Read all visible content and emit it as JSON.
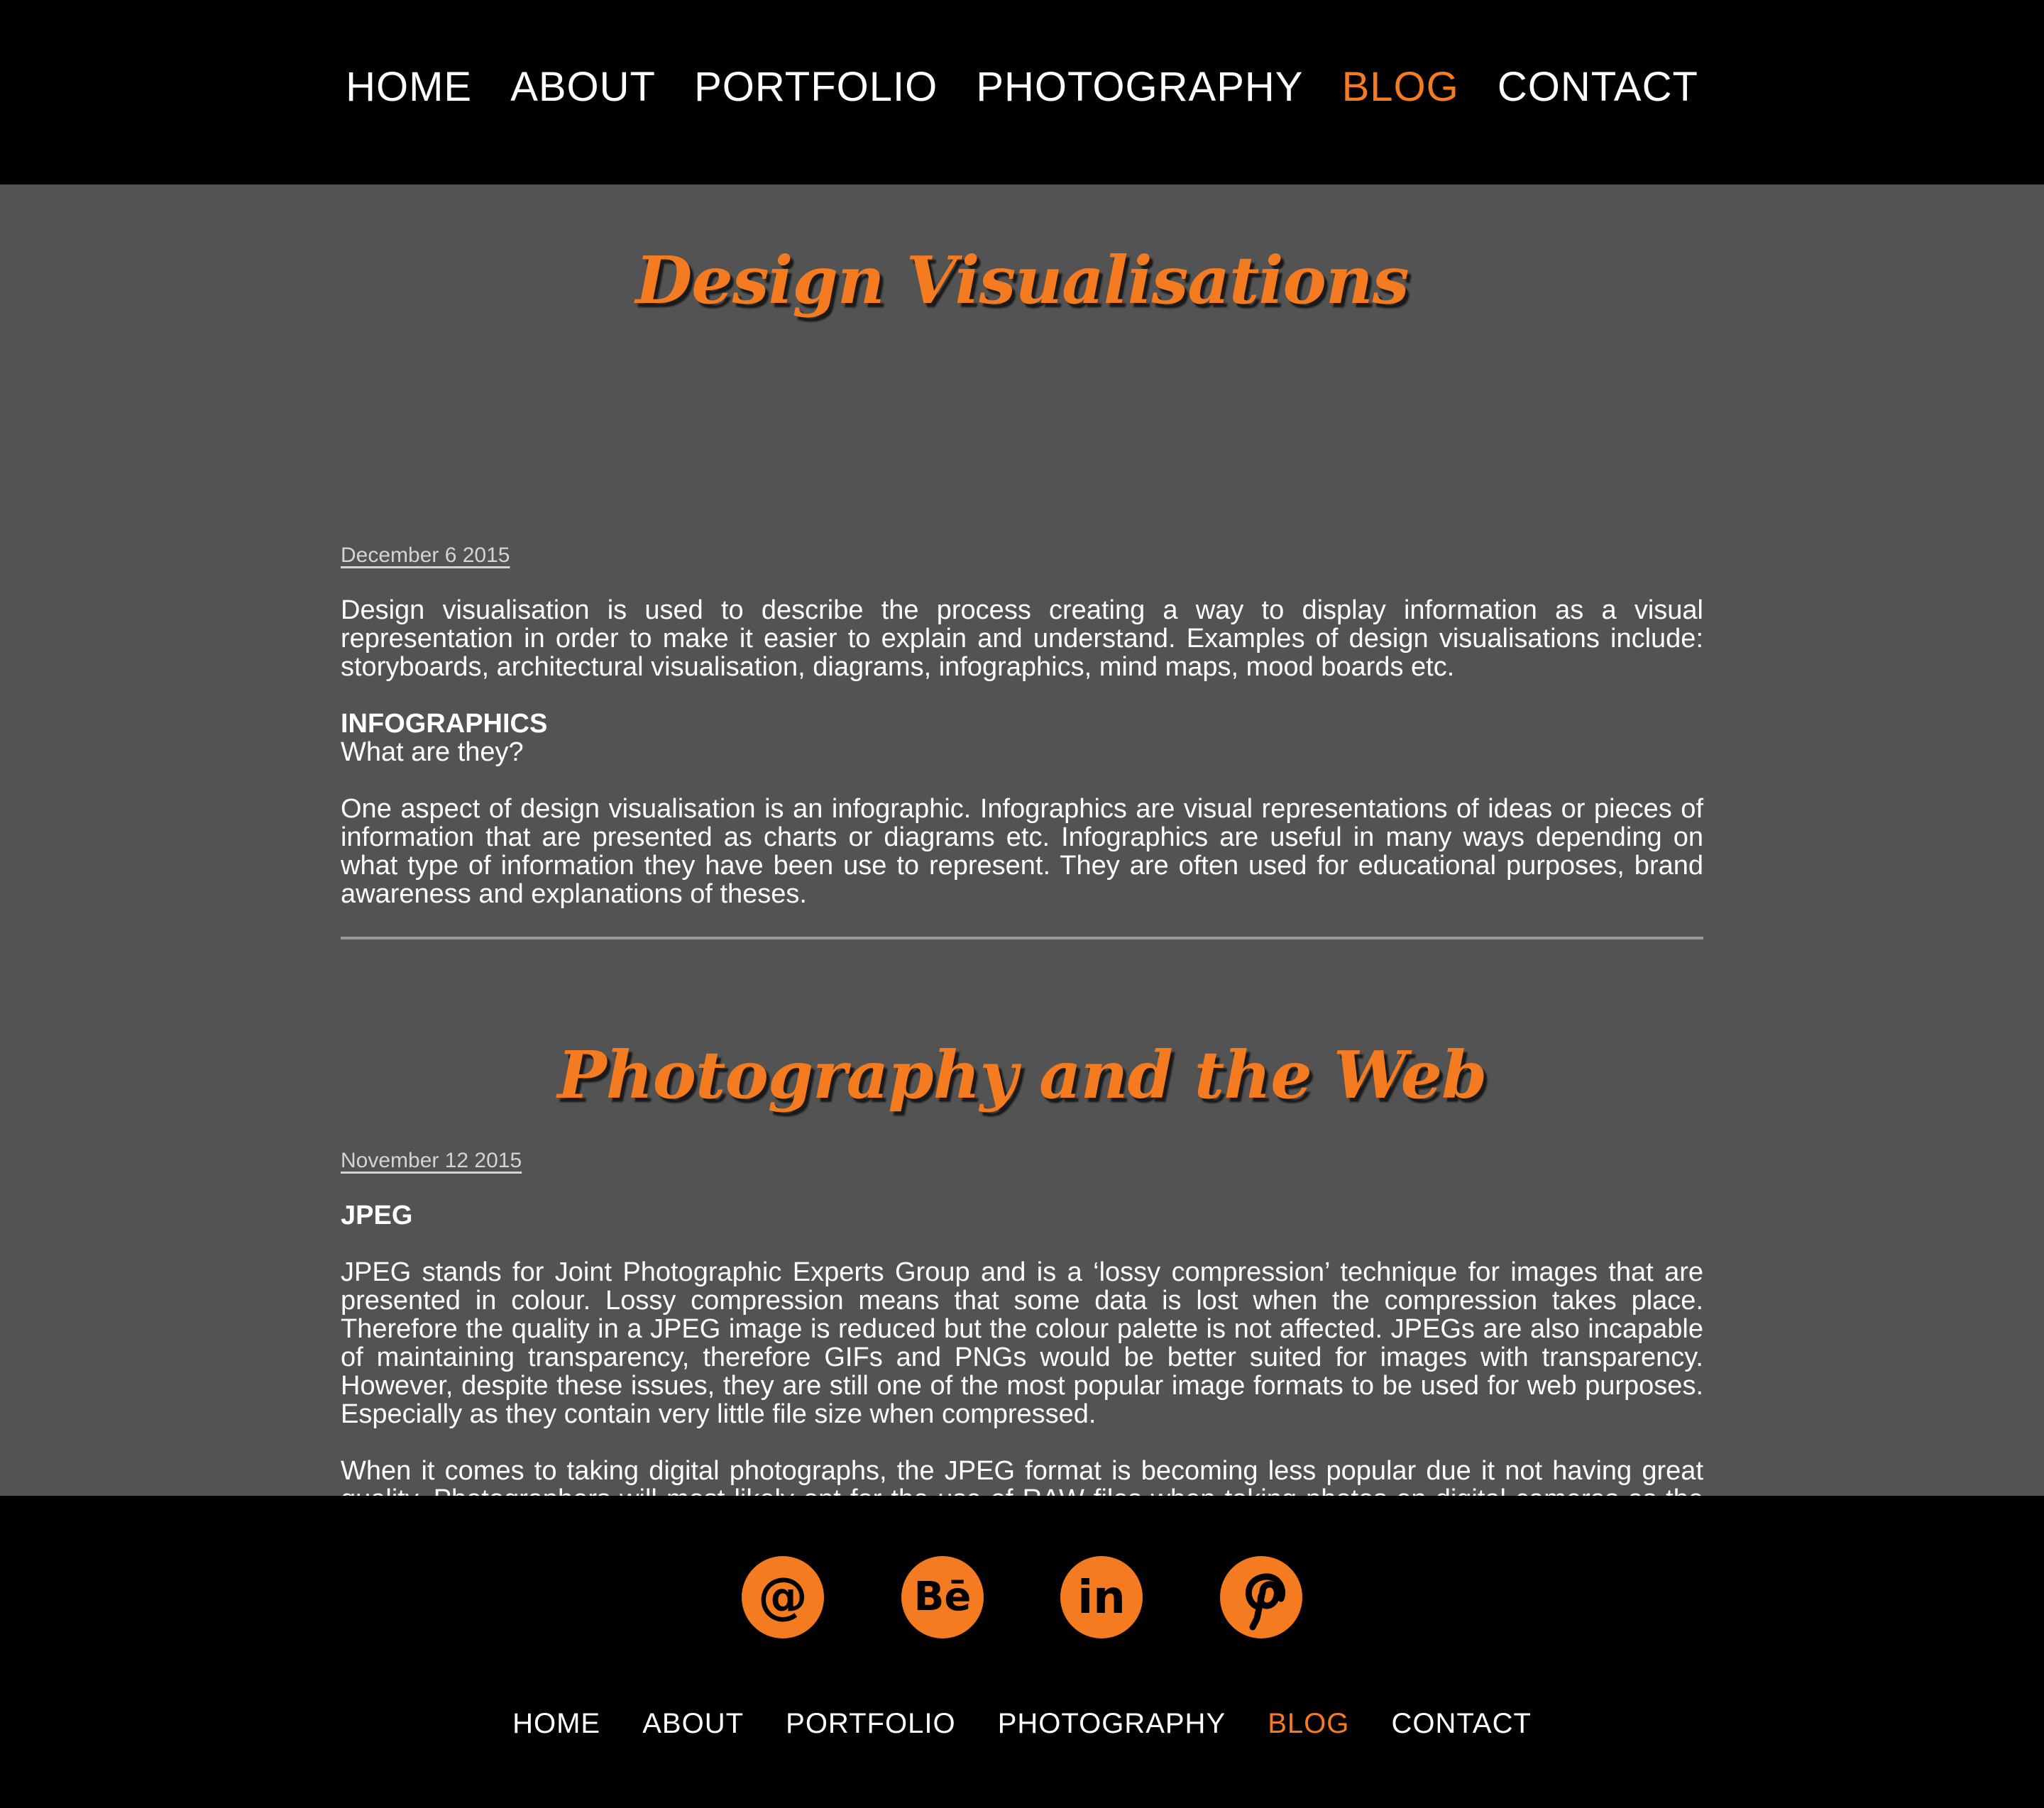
{
  "colors": {
    "accent": "#f47b20",
    "header_bg": "#000000",
    "main_bg": "#535353",
    "text": "#ffffff",
    "divider": "#9a9a9a"
  },
  "nav": {
    "items": [
      {
        "label": "HOME",
        "active": false
      },
      {
        "label": "ABOUT",
        "active": false
      },
      {
        "label": "PORTFOLIO",
        "active": false
      },
      {
        "label": "PHOTOGRAPHY",
        "active": false
      },
      {
        "label": "BLOG",
        "active": true
      },
      {
        "label": "CONTACT",
        "active": false
      }
    ]
  },
  "posts": [
    {
      "title": "Design Visualisations",
      "date": "December 6 2015",
      "intro": "Design visualisation is used to describe the process creating a way to display information as a visual representation in order to make it easier to explain and understand. Examples of design visualisations include: storyboards, architectural visualisation, diagrams, infographics, mind maps, mood boards etc.",
      "subheading": "INFOGRAPHICS",
      "question": "What are they?",
      "body": "One aspect of design visualisation is an infographic. Infographics are visual representations of ideas or pieces of information that are presented as charts or diagrams etc. Infographics are useful in many ways depending on what type of information they have been use to represent. They are often used for educational purposes, brand awareness and explanations of theses."
    },
    {
      "title": "Photography and the Web",
      "date": "November 12 2015",
      "subheading": "JPEG",
      "body1": "JPEG stands for Joint Photographic Experts Group and is a ‘lossy compression’ technique for images that are presented in colour. Lossy compression means that some data is lost when the compression takes place. Therefore the quality in a JPEG image is reduced but the colour palette is not affected. JPEGs are also incapable of maintaining transparency, therefore GIFs and PNGs would be better suited for images with transparency. However, despite these issues, they are still one of the most popular image formats to be used for web purposes. Especially as they contain very little file size when compressed.",
      "body2": "When it comes to taking digital photographs, the JPEG format is becoming less popular due it not having great quality. Photographers will most likely opt for the use of RAW files when taking photos on digital cameras as the image quality is far greater than JPEGs. RAW files can also be edited well, scaled without losing quality and used for large photos such as those seen on billboards."
    }
  ],
  "footer": {
    "social": [
      {
        "icon": "email-icon",
        "glyph": "@"
      },
      {
        "icon": "behance-icon",
        "glyph": "Bē"
      },
      {
        "icon": "linkedin-icon",
        "glyph": "in"
      },
      {
        "icon": "pinterest-icon",
        "glyph": "p"
      }
    ],
    "nav": [
      {
        "label": "HOME",
        "active": false
      },
      {
        "label": "ABOUT",
        "active": false
      },
      {
        "label": "PORTFOLIO",
        "active": false
      },
      {
        "label": "PHOTOGRAPHY",
        "active": false
      },
      {
        "label": "BLOG",
        "active": true
      },
      {
        "label": "CONTACT",
        "active": false
      }
    ]
  }
}
